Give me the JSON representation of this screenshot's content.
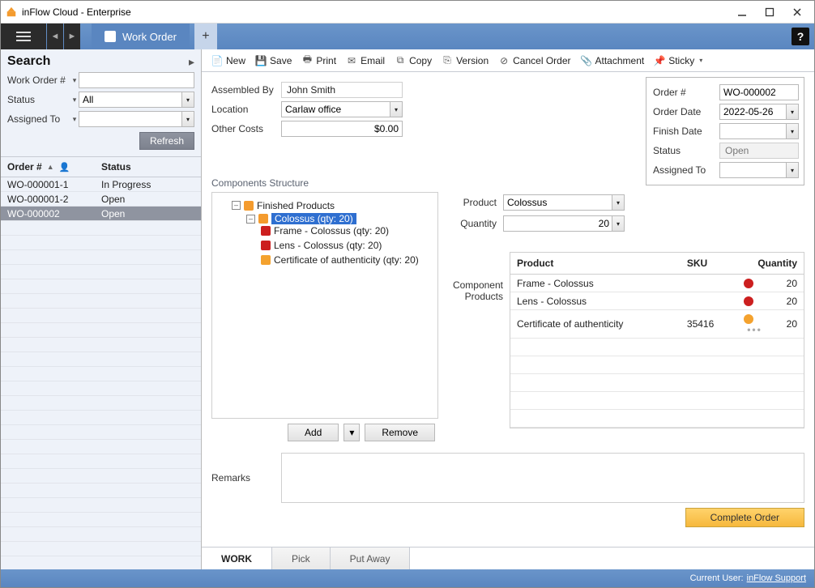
{
  "window": {
    "title": "inFlow Cloud - Enterprise"
  },
  "tab": {
    "label": "Work Order"
  },
  "toolbar": {
    "new": "New",
    "save": "Save",
    "print": "Print",
    "email": "Email",
    "copy": "Copy",
    "version": "Version",
    "cancel": "Cancel Order",
    "attachment": "Attachment",
    "sticky": "Sticky"
  },
  "search": {
    "heading": "Search",
    "filters": {
      "work_order_label": "Work Order #",
      "work_order_value": "",
      "status_label": "Status",
      "status_value": "All",
      "assigned_label": "Assigned To",
      "assigned_value": ""
    },
    "refresh": "Refresh",
    "columns": {
      "order": "Order #",
      "status": "Status"
    },
    "rows": [
      {
        "order": "WO-000001-1",
        "status": "In Progress",
        "selected": false
      },
      {
        "order": "WO-000001-2",
        "status": "Open",
        "selected": false
      },
      {
        "order": "WO-000002",
        "status": "Open",
        "selected": true
      }
    ]
  },
  "header_left": {
    "assembled_by_label": "Assembled By",
    "assembled_by": "John Smith",
    "location_label": "Location",
    "location": "Carlaw office",
    "other_costs_label": "Other Costs",
    "other_costs": "$0.00"
  },
  "header_right": {
    "order_no_label": "Order #",
    "order_no": "WO-000002",
    "order_date_label": "Order Date",
    "order_date": "2022-05-26",
    "finish_date_label": "Finish Date",
    "finish_date": "",
    "status_label": "Status",
    "status": "Open",
    "assigned_to_label": "Assigned To",
    "assigned_to": ""
  },
  "components": {
    "title": "Components Structure",
    "tree": {
      "root": "Finished Products",
      "selected": "Colossus  (qty: 20)",
      "children": [
        {
          "label": "Frame - Colossus  (qty: 20)",
          "status": "red"
        },
        {
          "label": "Lens - Colossus  (qty: 20)",
          "status": "red"
        },
        {
          "label": "Certificate of authenticity  (qty: 20)",
          "status": "yellow"
        }
      ]
    },
    "product_label": "Product",
    "product": "Colossus",
    "quantity_label": "Quantity",
    "quantity": "20",
    "component_products_label": "Component Products",
    "table": {
      "cols": {
        "product": "Product",
        "sku": "SKU",
        "qty": "Quantity"
      },
      "rows": [
        {
          "product": "Frame - Colossus",
          "sku": "",
          "status": "red",
          "qty": "20"
        },
        {
          "product": "Lens - Colossus",
          "sku": "",
          "status": "red",
          "qty": "20"
        },
        {
          "product": "Certificate of authenticity",
          "sku": "35416",
          "status": "yellow",
          "qty": "20"
        }
      ]
    },
    "add_btn": "Add",
    "remove_btn": "Remove"
  },
  "remarks_label": "Remarks",
  "remarks": "",
  "complete_btn": "Complete Order",
  "bottom_tabs": {
    "work": "WORK",
    "pick": "Pick",
    "putaway": "Put Away"
  },
  "statusbar": {
    "label": "Current User:",
    "user": "inFlow Support"
  }
}
